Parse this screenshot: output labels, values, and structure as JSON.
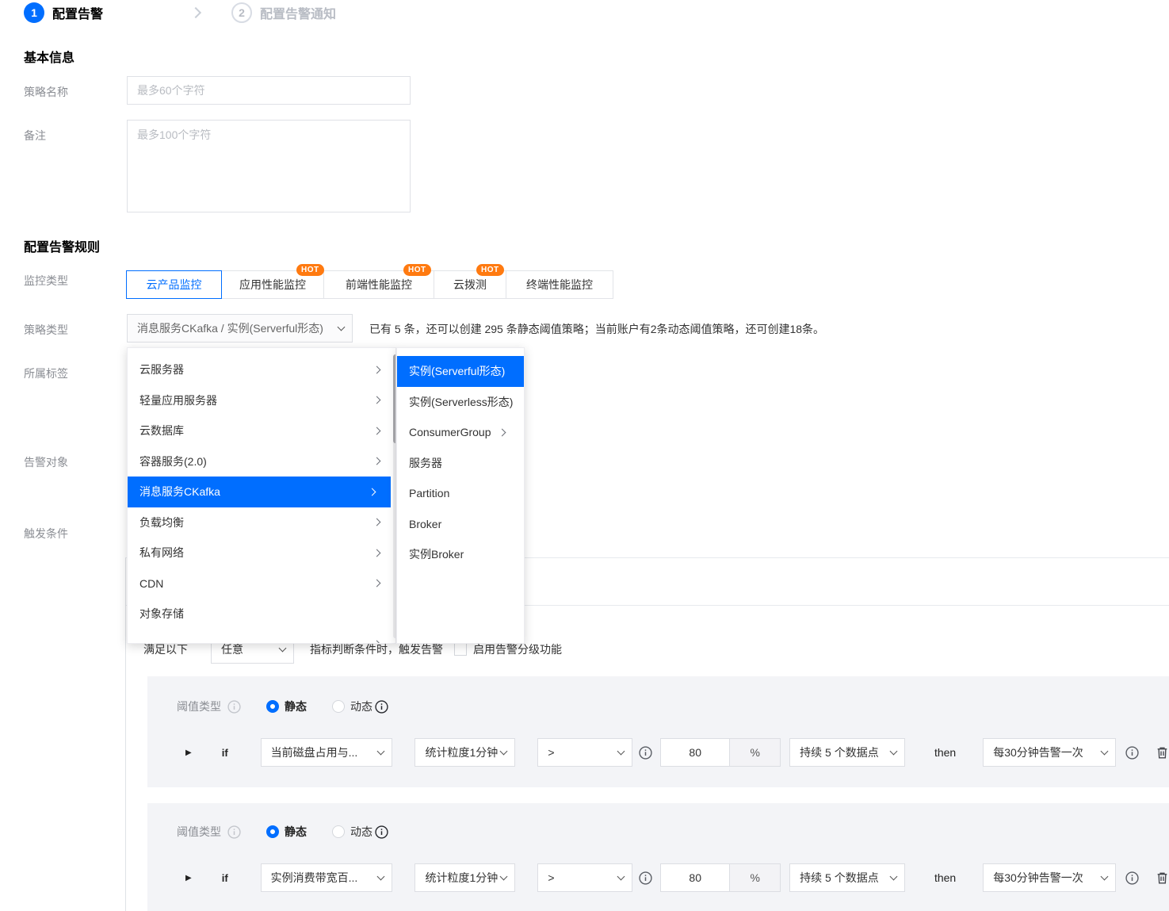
{
  "colors": {
    "accent": "#006eff",
    "hot_badge": "#ff7a10",
    "panel_bg": "#f3f4f7"
  },
  "steps": {
    "step1_num": "1",
    "step1_label": "配置告警",
    "step2_num": "2",
    "step2_label": "配置告警通知"
  },
  "basic_info": {
    "heading": "基本信息",
    "policy_name_label": "策略名称",
    "policy_name_placeholder": "最多60个字符",
    "remark_label": "备注",
    "remark_placeholder": "最多100个字符"
  },
  "rules": {
    "heading": "配置告警规则",
    "monitor_type_label": "监控类型",
    "hot_badge": "HOT",
    "tabs": [
      {
        "label": "云产品监控",
        "selected": true,
        "hot": false
      },
      {
        "label": "应用性能监控",
        "selected": false,
        "hot": true
      },
      {
        "label": "前端性能监控",
        "selected": false,
        "hot": true
      },
      {
        "label": "云拨测",
        "selected": false,
        "hot": true
      },
      {
        "label": "终端性能监控",
        "selected": false,
        "hot": false
      }
    ],
    "policy_type_label": "策略类型",
    "policy_type_value": "消息服务CKafka / 实例(Serverful形态)",
    "policy_type_hint": "已有 5 条，还可以创建 295 条静态阈值策略；当前账户有2条动态阈值策略，还可创建18条。",
    "tag_label": "所属标签",
    "alarm_object_label": "告警对象",
    "trigger_condition_label": "触发条件",
    "condition_prefix": "满足以下",
    "condition_select_value": "任意",
    "condition_suffix": "指标判断条件时，触发告警",
    "grading_checkbox_label": "启用告警分级功能"
  },
  "menu": {
    "items": [
      {
        "label": "云服务器"
      },
      {
        "label": "轻量应用服务器"
      },
      {
        "label": "云数据库"
      },
      {
        "label": "容器服务(2.0)"
      },
      {
        "label": "消息服务CKafka"
      },
      {
        "label": "负载均衡"
      },
      {
        "label": "私有网络"
      },
      {
        "label": "CDN"
      },
      {
        "label": "对象存储"
      }
    ],
    "selected_item": "消息服务CKafka",
    "submenu": [
      {
        "label": "实例(Serverful形态)"
      },
      {
        "label": "实例(Serverless形态)"
      },
      {
        "label": "ConsumerGroup"
      },
      {
        "label": "服务器"
      },
      {
        "label": "Partition"
      },
      {
        "label": "Broker"
      },
      {
        "label": "实例Broker"
      }
    ],
    "selected_subitem": "实例(Serverful形态)"
  },
  "rule_labels": {
    "threshold_type": "阈值类型",
    "static": "静态",
    "dynamic": "动态",
    "if": "if",
    "then": "then"
  },
  "rule_blocks": [
    {
      "metric": "当前磁盘占用与...",
      "granularity": "统计粒度1分钟",
      "operator": ">",
      "value": "80",
      "unit": "%",
      "duration": "持续 5 个数据点",
      "frequency": "每30分钟告警一次"
    },
    {
      "metric": "实例消费带宽百...",
      "granularity": "统计粒度1分钟",
      "operator": ">",
      "value": "80",
      "unit": "%",
      "duration": "持续 5 个数据点",
      "frequency": "每30分钟告警一次"
    }
  ]
}
